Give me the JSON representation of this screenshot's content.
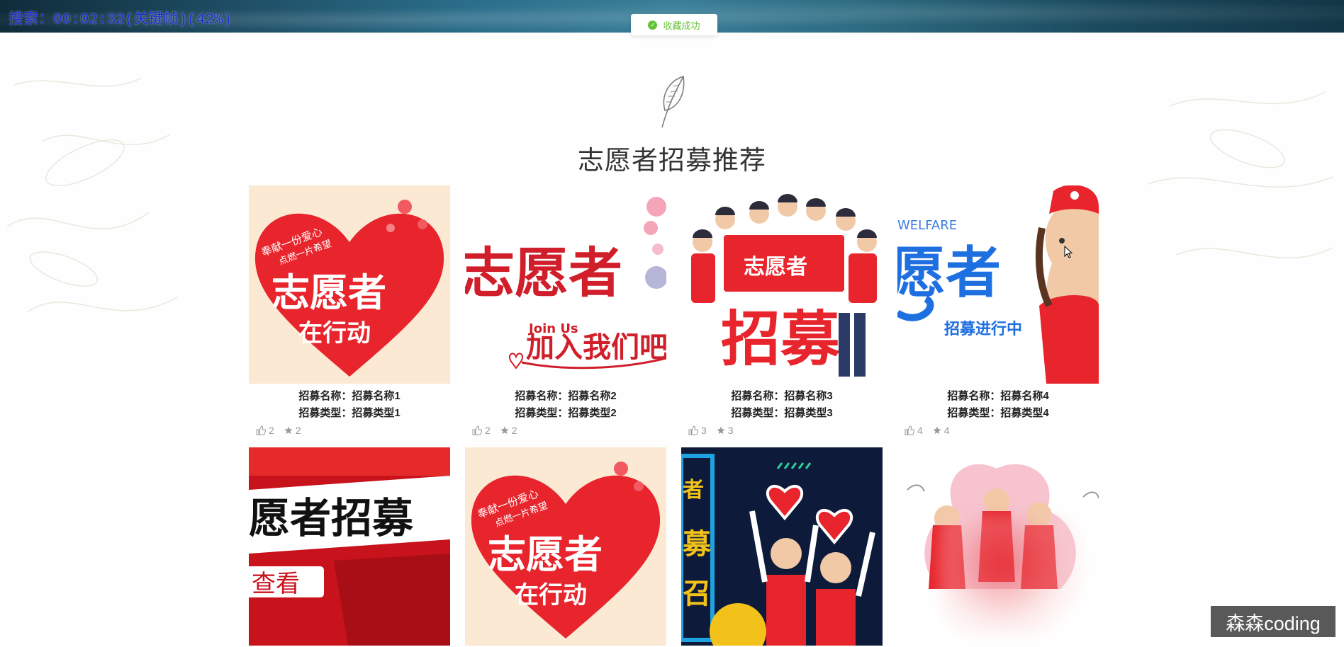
{
  "overlay": {
    "search_status": "搜索：00:02:32(关键帧)(42%)"
  },
  "toast": {
    "message": "收藏成功",
    "icon": "check-circle-icon"
  },
  "section": {
    "title": "志愿者招募推荐",
    "icon": "leaf-icon"
  },
  "cards": [
    {
      "name_label": "招募名称：招募名称1",
      "type_label": "招募类型：招募类型1",
      "likes": "2",
      "favorites": "2",
      "image_texts": [
        "奉献一份爱心",
        "点燃一片希望",
        "志愿者",
        "在行动"
      ]
    },
    {
      "name_label": "招募名称：招募名称2",
      "type_label": "招募类型：招募类型2",
      "likes": "2",
      "favorites": "2",
      "image_texts": [
        "志愿者",
        "Join Us",
        "加入我们吧"
      ]
    },
    {
      "name_label": "招募名称：招募名称3",
      "type_label": "招募类型：招募类型3",
      "likes": "3",
      "favorites": "3",
      "image_texts": [
        "志愿者",
        "招募"
      ]
    },
    {
      "name_label": "招募名称：招募名称4",
      "type_label": "招募类型：招募类型4",
      "likes": "4",
      "favorites": "4",
      "image_texts": [
        "WELFARE",
        "愿者",
        "招募进行中"
      ]
    },
    {
      "image_texts": [
        "愿者招募",
        "查看"
      ]
    },
    {
      "image_texts": [
        "奉献一份爱心",
        "点燃一片希望",
        "志愿者",
        "在行动"
      ]
    },
    {
      "image_texts": [
        "者",
        "募",
        "召"
      ]
    },
    {
      "image_texts": []
    }
  ],
  "watermark": "森森coding",
  "colors": {
    "toast_green": "#67c23a",
    "poster_red": "#e8242c",
    "overlay_blue": "#1a2bd6"
  }
}
